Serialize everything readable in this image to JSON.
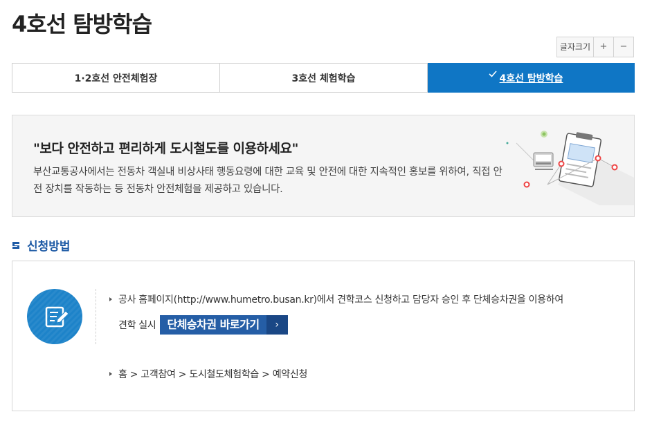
{
  "page": {
    "title": "4호선 탐방학습"
  },
  "font_size_control": {
    "label": "글자크기",
    "increase": "+",
    "decrease": "−"
  },
  "tabs": [
    {
      "label": "1·2호선 안전체험장",
      "active": false
    },
    {
      "label": "3호선 체험학습",
      "active": false
    },
    {
      "label": "4호선 탐방학습",
      "active": true
    }
  ],
  "intro": {
    "heading": "\"보다 안전하고 편리하게 도시철도를 이용하세요\"",
    "body": "부산교통공사에서는 전동차 객실내 비상사태 행동요령에 대한 교육 및 안전에 대한 지속적인 홍보를 위하여, 직접 안전 장치를 작동하는 등 전동차 안전체험을 제공하고 있습니다."
  },
  "section": {
    "title": "신청방법"
  },
  "method": {
    "line1": "공사 홈페이지(http://www.humetro.busan.kr)에서 견학코스 신청하고 담당자 승인 후 단체승차권을 이용하여",
    "line2": "견학 실시",
    "shortcut_button": "단체승차권 바로가기",
    "shortcut_arrow": "›",
    "path": "홈 > 고객참여 > 도시철도체험학습 > 예약신청"
  },
  "colors": {
    "accent": "#0f76c5",
    "section": "#1d5aa5",
    "button": "#255ea6",
    "button_dark": "#1a4785"
  },
  "icons": {
    "method": "document-edit-icon",
    "section": "section-marker-icon"
  }
}
